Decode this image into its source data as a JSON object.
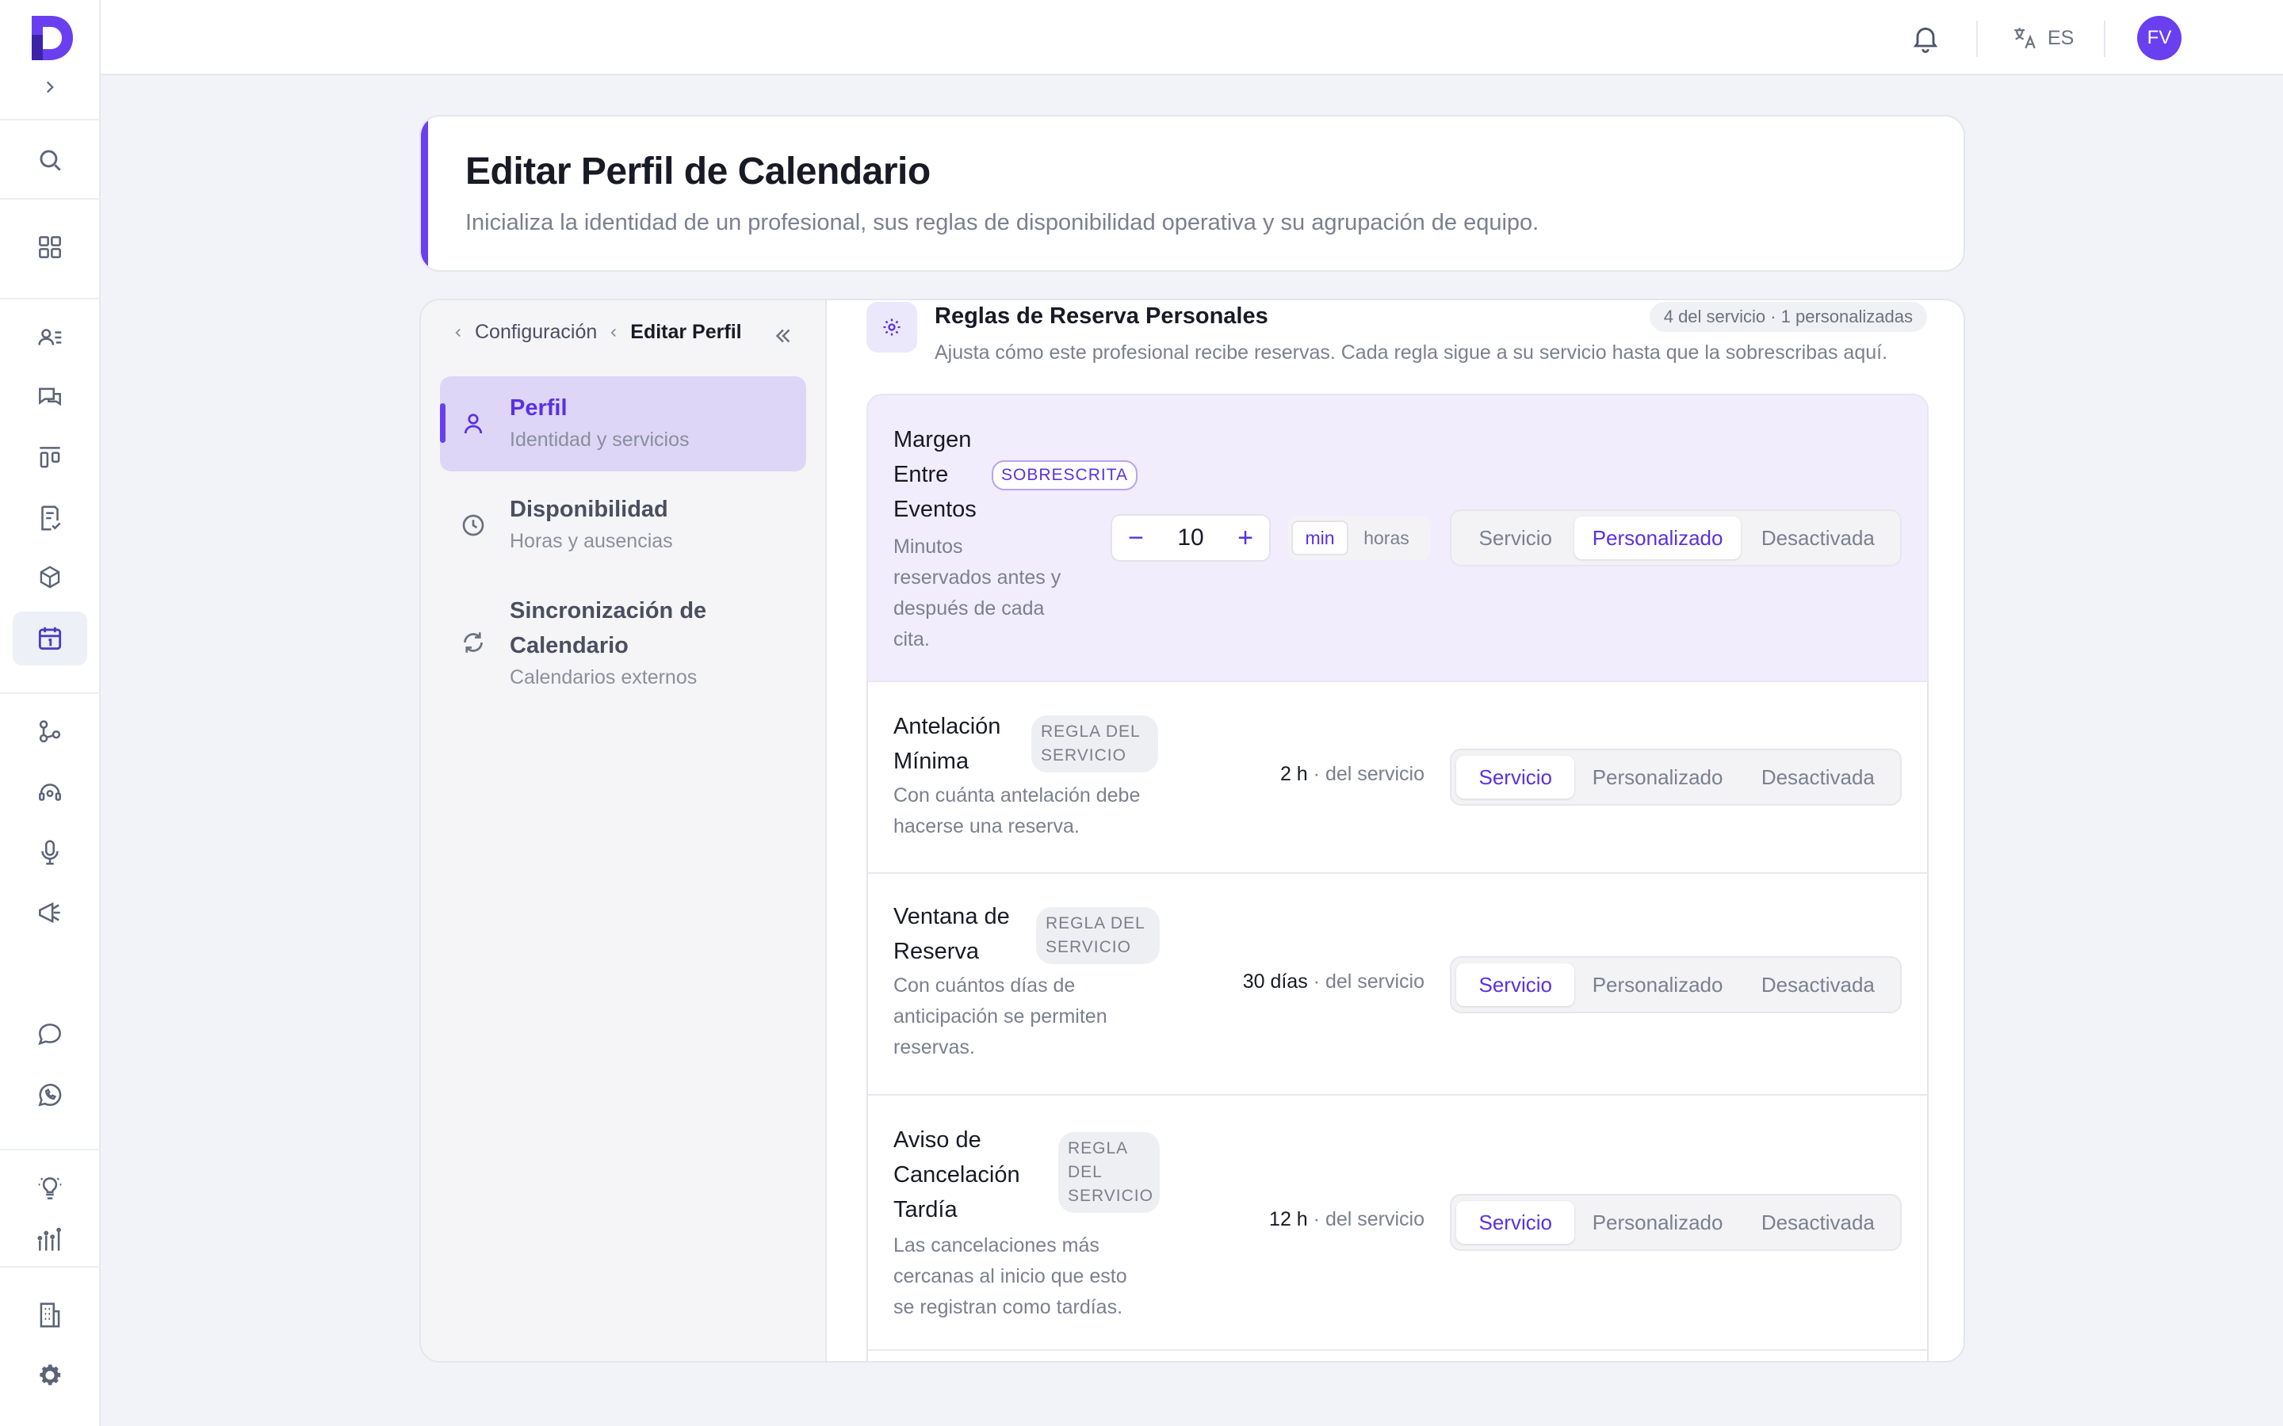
{
  "topbar": {
    "language": "ES",
    "avatar_initials": "FV"
  },
  "header": {
    "title": "Editar Perfil de Calendario",
    "subtitle": "Inicializa la identidad de un profesional, sus reglas de disponibilidad operativa y su agrupación de equipo."
  },
  "breadcrumb": {
    "parent": "Configuración",
    "current": "Editar Perfil"
  },
  "nav": [
    {
      "title": "Perfil",
      "subtitle": "Identidad y servicios"
    },
    {
      "title": "Disponibilidad",
      "subtitle": "Horas y ausencias"
    },
    {
      "title_line1": "Sincronización de",
      "title_line2": "Calendario",
      "subtitle": "Calendarios externos"
    }
  ],
  "section": {
    "title": "Reglas de Reserva Personales",
    "description": "Ajusta cómo este profesional recibe reservas. Cada regla sigue a su servicio hasta que la sobrescribas aquí.",
    "badge": "4 del servicio · 1 personalizadas"
  },
  "segment_options": [
    "Servicio",
    "Personalizado",
    "Desactivada"
  ],
  "rules": [
    {
      "title_lines": [
        "Margen",
        "Entre",
        "Eventos"
      ],
      "tag": "SOBRESCRITA",
      "desc_lines": [
        "Minutos",
        "reservados antes y",
        "después de cada",
        "cita."
      ],
      "stepper_value": "10",
      "units": [
        "min",
        "horas"
      ],
      "selected": "Personalizado"
    },
    {
      "title_lines": [
        "Antelación",
        "Mínima"
      ],
      "tag_lines": [
        "REGLA DEL",
        "SERVICIO"
      ],
      "desc_lines": [
        "Con cuánta antelación debe",
        "hacerse una reserva."
      ],
      "value": "2 h",
      "value_suffix": "· del servicio",
      "selected": "Servicio"
    },
    {
      "title_lines": [
        "Ventana de",
        "Reserva"
      ],
      "tag_lines": [
        "REGLA DEL",
        "SERVICIO"
      ],
      "desc_lines": [
        "Con cuántos días de",
        "anticipación se permiten",
        "reservas."
      ],
      "value": "30 días",
      "value_suffix": "· del servicio",
      "selected": "Servicio"
    },
    {
      "title_lines": [
        "Aviso de",
        "Cancelación",
        "Tardía"
      ],
      "tag_lines": [
        "REGLA",
        "DEL",
        "SERVICIO"
      ],
      "desc_lines": [
        "Las cancelaciones más",
        "cercanas al inicio que esto",
        "se registran como tardías."
      ],
      "value": "12 h",
      "value_suffix": "· del servicio",
      "selected": "Servicio"
    }
  ],
  "colors": {
    "accent": "#6a3ff0",
    "accent_text": "#5a31e0",
    "override_bg": "#f1edfd"
  }
}
